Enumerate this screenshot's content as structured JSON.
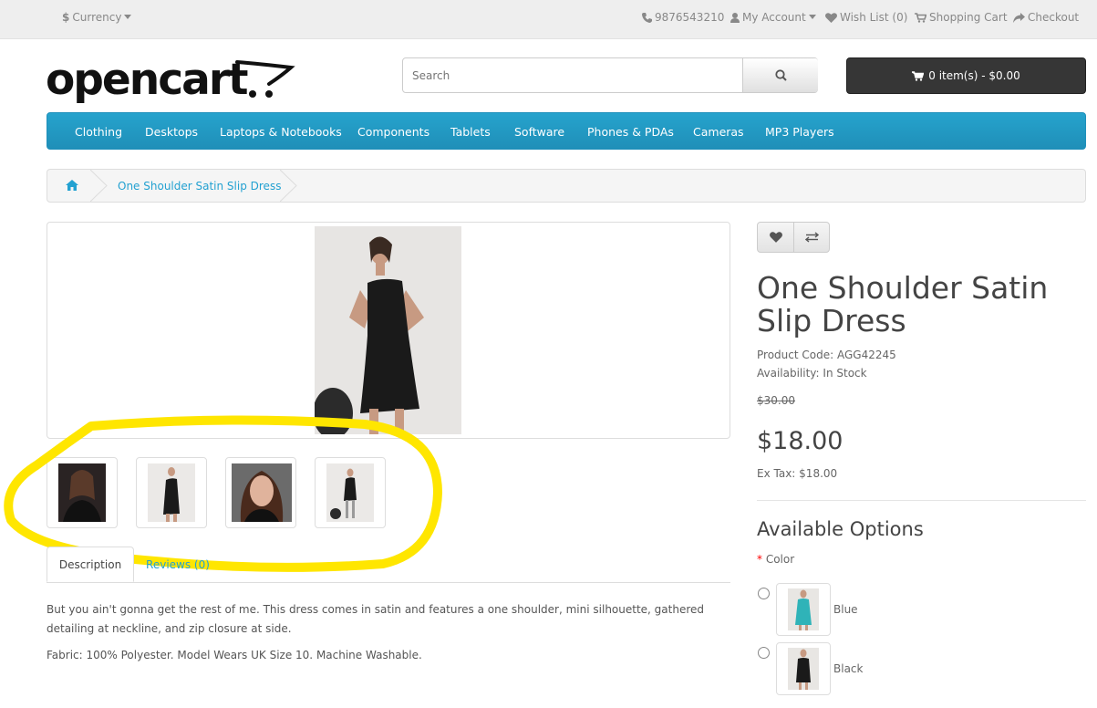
{
  "topbar": {
    "currency": "Currency",
    "phone": "9876543210",
    "my_account": "My Account",
    "wish_list": "Wish List (0)",
    "shopping_cart": "Shopping Cart",
    "checkout": "Checkout"
  },
  "logo": {
    "text": "opencart"
  },
  "search": {
    "placeholder": "Search"
  },
  "cart": {
    "label": "0 item(s) - $0.00"
  },
  "menu": [
    "Clothing",
    "Desktops",
    "Laptops & Notebooks",
    "Components",
    "Tablets",
    "Software",
    "Phones & PDAs",
    "Cameras",
    "MP3 Players"
  ],
  "breadcrumb": {
    "current": "One Shoulder Satin Slip Dress"
  },
  "tabs": {
    "description": "Description",
    "reviews": "Reviews (0)"
  },
  "description": {
    "p1": "But you ain't gonna get the rest of me. This dress comes in satin and features a one shoulder, mini silhouette, gathered detailing at neckline, and zip closure at side.",
    "p2": "Fabric: 100% Polyester. Model Wears UK Size 10. Machine Washable."
  },
  "product": {
    "title": "One Shoulder Satin Slip Dress",
    "code_label": "Product Code:",
    "code": "AGG42245",
    "availability_label": "Availability:",
    "availability": "In Stock",
    "old_price": "$30.00",
    "price": "$18.00",
    "ex_tax_label": "Ex Tax:",
    "ex_tax": "$18.00"
  },
  "options": {
    "title": "Available Options",
    "required_mark": "*",
    "color_label": "Color",
    "values": [
      "Blue",
      "Black"
    ]
  },
  "colors": {
    "accent": "#23a1d1",
    "menu": "#229ac8",
    "highlight": "#ffe600"
  }
}
